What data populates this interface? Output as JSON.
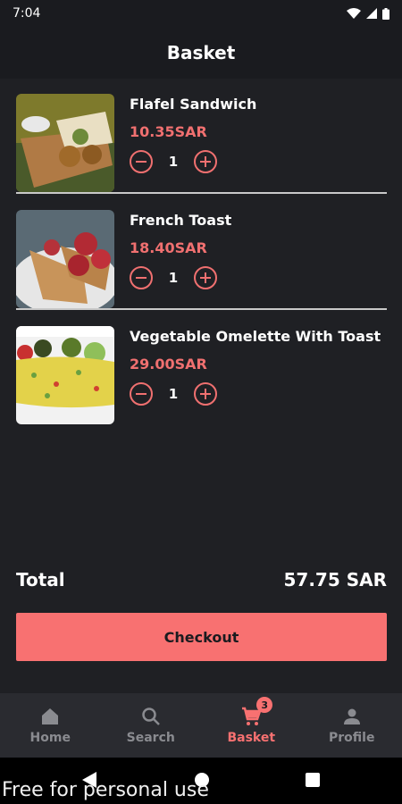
{
  "status_bar": {
    "time": "7:04"
  },
  "header": {
    "title": "Basket"
  },
  "items": [
    {
      "name": "Flafel Sandwich",
      "price": "10.35SAR",
      "quantity": "1"
    },
    {
      "name": "French Toast",
      "price": "18.40SAR",
      "quantity": "1"
    },
    {
      "name": "Vegetable Omelette With Toast",
      "price": "29.00SAR",
      "quantity": "1"
    }
  ],
  "total": {
    "label": "Total",
    "value": "57.75 SAR"
  },
  "checkout": {
    "label": "Checkout"
  },
  "bottom_nav": {
    "items": [
      {
        "label": "Home",
        "icon": "home-icon"
      },
      {
        "label": "Search",
        "icon": "search-icon"
      },
      {
        "label": "Basket",
        "icon": "cart-icon",
        "badge": "3",
        "active": true
      },
      {
        "label": "Profile",
        "icon": "person-icon"
      }
    ]
  },
  "watermark": "Free for personal use",
  "colors": {
    "accent": "#f87171",
    "background": "#1f2024",
    "bar": "#1a1b1f"
  }
}
